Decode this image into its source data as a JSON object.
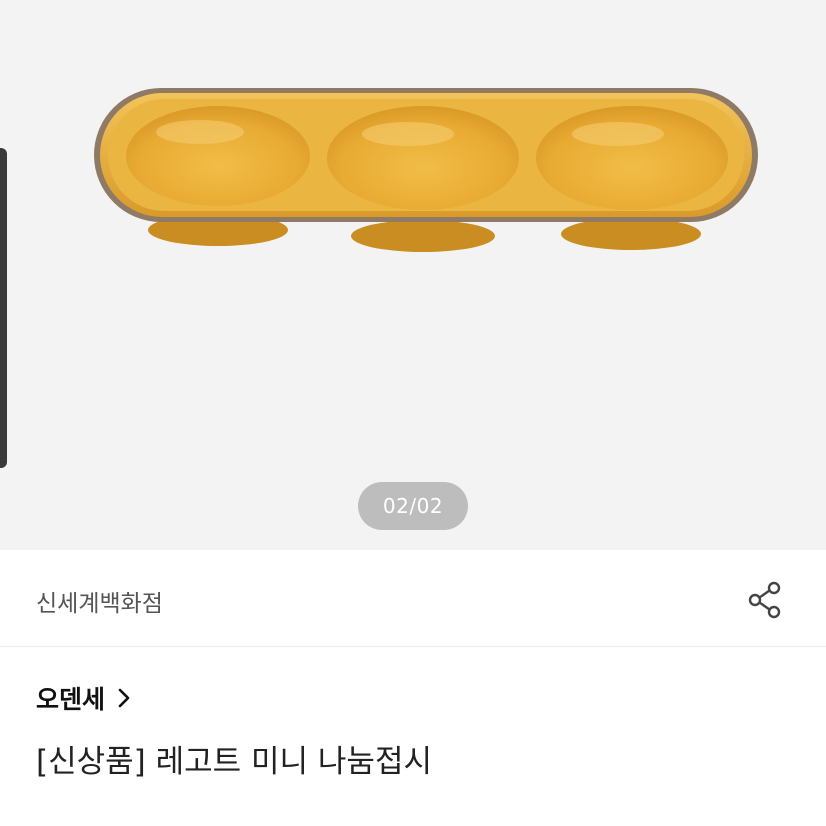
{
  "gallery": {
    "counter": "02/02",
    "image_alt": "three-compartment mustard yellow ceramic dish"
  },
  "seller": {
    "name": "신세계백화점",
    "share_icon": "share-icon"
  },
  "product": {
    "brand": "오덴세",
    "brand_chevron_icon": "chevron-right-icon",
    "title": "[신상품] 레고트 미니 나눔접시"
  },
  "colors": {
    "gallery_bg": "#f3f3f4",
    "dish_yellow": "#e8b03a",
    "dish_rim": "#8f7a66",
    "counter_bg": "#bdbdbd"
  }
}
